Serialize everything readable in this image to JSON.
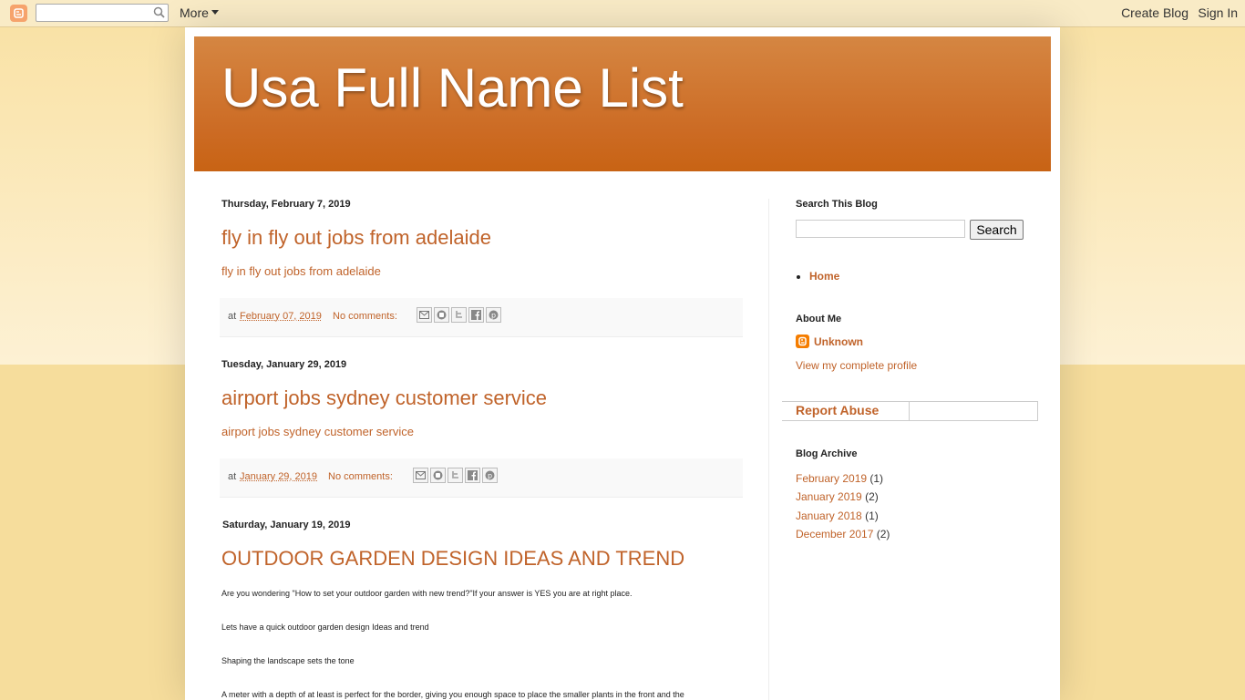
{
  "navbar": {
    "more_label": "More",
    "create_blog": "Create Blog",
    "sign_in": "Sign In"
  },
  "blog": {
    "title": "Usa Full Name List"
  },
  "posts": [
    {
      "date": "Thursday, February 7, 2019",
      "title": "fly in fly out jobs from adelaide",
      "snippet": "fly in fly out jobs from adelaide",
      "at": "at",
      "post_date": "February 07, 2019",
      "comments": "No comments:"
    },
    {
      "date": "Tuesday, January 29, 2019",
      "title": "airport jobs sydney customer service",
      "snippet": "airport jobs sydney customer service",
      "at": "at",
      "post_date": "January 29, 2019",
      "comments": "No comments:"
    },
    {
      "date": "Saturday, January 19, 2019",
      "title": "OUTDOOR GARDEN DESIGN IDEAS AND TREND",
      "body": [
        "Are you wondering \"How to set your outdoor garden with new trend?\"If your answer is YES you are at right place.",
        "Lets have a quick outdoor garden design Ideas and trend",
        "Shaping the landscape sets the tone",
        "A meter with a depth of at least is perfect for the border, giving you enough space to place the smaller plants in the front and the"
      ]
    }
  ],
  "sidebar": {
    "search_heading": "Search This Blog",
    "search_button": "Search",
    "pages": [
      "Home"
    ],
    "about_heading": "About Me",
    "profile_name": "Unknown",
    "profile_link": "View my complete profile",
    "report_abuse": "Report Abuse",
    "archive_heading": "Blog Archive",
    "archive": [
      {
        "label": "February 2019",
        "count": "(1)"
      },
      {
        "label": "January 2019",
        "count": "(2)"
      },
      {
        "label": "January 2018",
        "count": "(1)"
      },
      {
        "label": "December 2017",
        "count": "(2)"
      }
    ]
  },
  "colors": {
    "accent": "#c0632a",
    "header": "#cc6b24",
    "background": "#f6dd9c"
  }
}
